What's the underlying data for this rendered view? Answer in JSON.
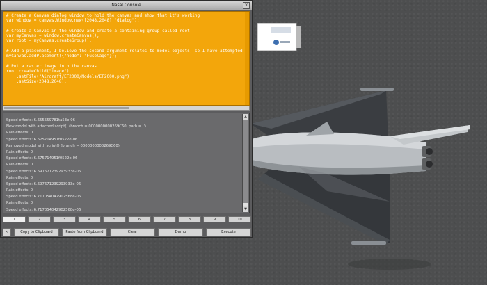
{
  "console": {
    "title": "Nasal Console",
    "close_glyph": "×",
    "code_lines": [
      "# Create a Canvas dialog window to hold the canvas and show that it's working",
      "var window = canvas.Window.new([2048,2048],\"dialog\");",
      "",
      "# Create a Canvas in the window and create a containing group called root",
      "var myCanvas = window.createCanvas();",
      "var root = myCanvas.createGroup();",
      "",
      "# Add a placement, I believe the second argument relates to model objects, so I have attempted to",
      "myCanvas.addPlacement({\"node\": \"Fuselage\"});",
      "",
      "# Put a raster image into the canvas",
      "root.createChild(\"image\")",
      "    .setFile(\"Aircraft/EF2000/Models/EF2000.png\")",
      "    .setSize(2048,2048);"
    ],
    "output_lines": [
      "Speed effects: 6.655559781ta53e-06",
      "New model with attached script() (branch = 0000000000269C60; path = '')",
      "Rain effects: 0",
      "Speed effects: 6.675714951f0522e-06",
      "Removed model with script() (branch = 0000000000269C60)",
      "Rain effects: 0",
      "Speed effects: 6.675714951f0522e-06",
      "Rain effects: 0",
      "Speed effects: 6.697671239293933e-06",
      "Rain effects: 0",
      "Speed effects: 6.697671239293933e-06",
      "Rain effects: 0",
      "Speed effects: 6.717054042902568e-06",
      "Rain effects: 0",
      "Speed effects: 6.717054042902568e-06"
    ],
    "history_buttons": [
      "1",
      "2",
      "3",
      "4",
      "5",
      "6",
      "7",
      "8",
      "9",
      "10"
    ],
    "actions": {
      "left_marker": "<",
      "copy": "Copy to Clipboard",
      "paste": "Paste from Clipboard",
      "clear": "Clear",
      "dump": "Dump",
      "execute": "Execute"
    }
  },
  "colors": {
    "editor_bg": "#f3a60b",
    "output_bg": "#6a6a6c",
    "terrain": "#4d4e4f"
  }
}
